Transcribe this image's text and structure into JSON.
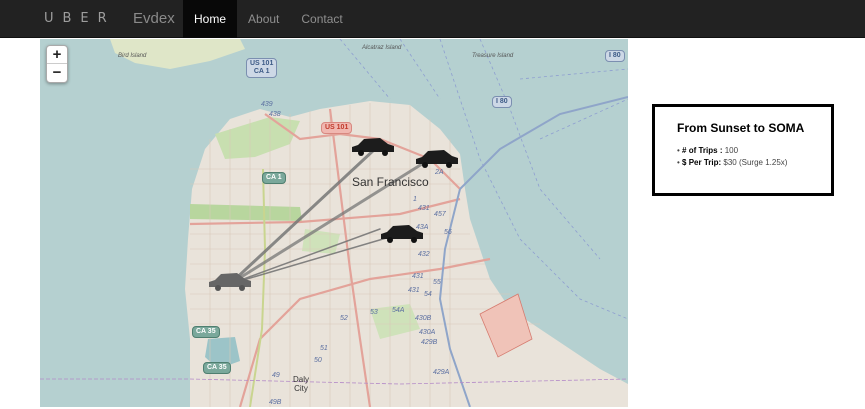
{
  "navbar": {
    "logo": "UBER",
    "brand": "Evdex",
    "links": [
      {
        "label": "Home",
        "active": true
      },
      {
        "label": "About",
        "active": false
      },
      {
        "label": "Contact",
        "active": false
      }
    ]
  },
  "map": {
    "zoom_in": "+",
    "zoom_out": "−",
    "labels": {
      "city": "San Francisco",
      "alcatraz": "Alcatraz Island",
      "treasure": "Treasure Island",
      "bird": "Bird Island",
      "daly_city": "Daly City"
    },
    "shields": {
      "us101_ca1": "US 101\nCA 1",
      "us101": "US 101",
      "ca1": "CA 1",
      "i80_a": "I 80",
      "i80_b": "I 80",
      "ca35_a": "CA 35",
      "ca35_b": "CA 35"
    },
    "routes": [
      "439",
      "438",
      "2A",
      "1",
      "431",
      "4",
      "57",
      "43A",
      "56",
      "432",
      "55",
      "431",
      "54",
      "431",
      "430B",
      "430A",
      "429B",
      "53",
      "54A",
      "52",
      "51",
      "50",
      "49",
      "49B",
      "429A"
    ],
    "car_icon": "car-icon",
    "trip_lines_color": "#777777"
  },
  "info": {
    "title": "From Sunset to SOMA",
    "trips_label": "# of Trips :",
    "trips_value": "100",
    "price_label": "$ Per Trip:",
    "price_value": "$30 (Surge 1.25x)"
  },
  "colors": {
    "navbar_bg": "#222222",
    "water": "#b5d0d0",
    "land": "#e8e0d8"
  }
}
